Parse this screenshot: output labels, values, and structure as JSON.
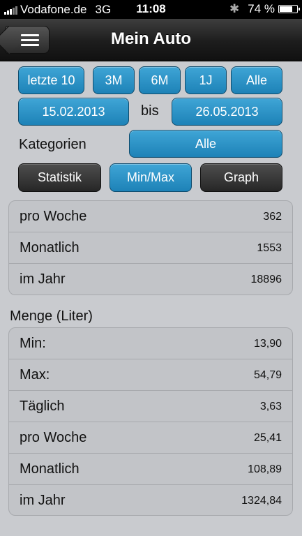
{
  "status": {
    "carrier": "Vodafone.de",
    "network": "3G",
    "time": "11:08",
    "battery": "74 %"
  },
  "nav": {
    "title": "Mein Auto"
  },
  "range_buttons": [
    "letzte 10",
    "3M",
    "6M",
    "1J",
    "Alle"
  ],
  "dates": {
    "from": "15.02.2013",
    "separator": "bis",
    "to": "26.05.2013"
  },
  "category": {
    "label": "Kategorien",
    "value": "Alle"
  },
  "view_tabs": [
    "Statistik",
    "Min/Max",
    "Graph"
  ],
  "distance_stats": [
    {
      "label": "pro Woche",
      "value": "362"
    },
    {
      "label": "Monatlich",
      "value": "1553"
    },
    {
      "label": "im Jahr",
      "value": "18896"
    }
  ],
  "fuel": {
    "header": "Menge (Liter)",
    "rows": [
      {
        "label": "Min:",
        "value": "13,90"
      },
      {
        "label": "Max:",
        "value": "54,79"
      },
      {
        "label": "Täglich",
        "value": "3,63"
      },
      {
        "label": "pro Woche",
        "value": "25,41"
      },
      {
        "label": "Monatlich",
        "value": "108,89"
      },
      {
        "label": "im Jahr",
        "value": "1324,84"
      }
    ]
  }
}
